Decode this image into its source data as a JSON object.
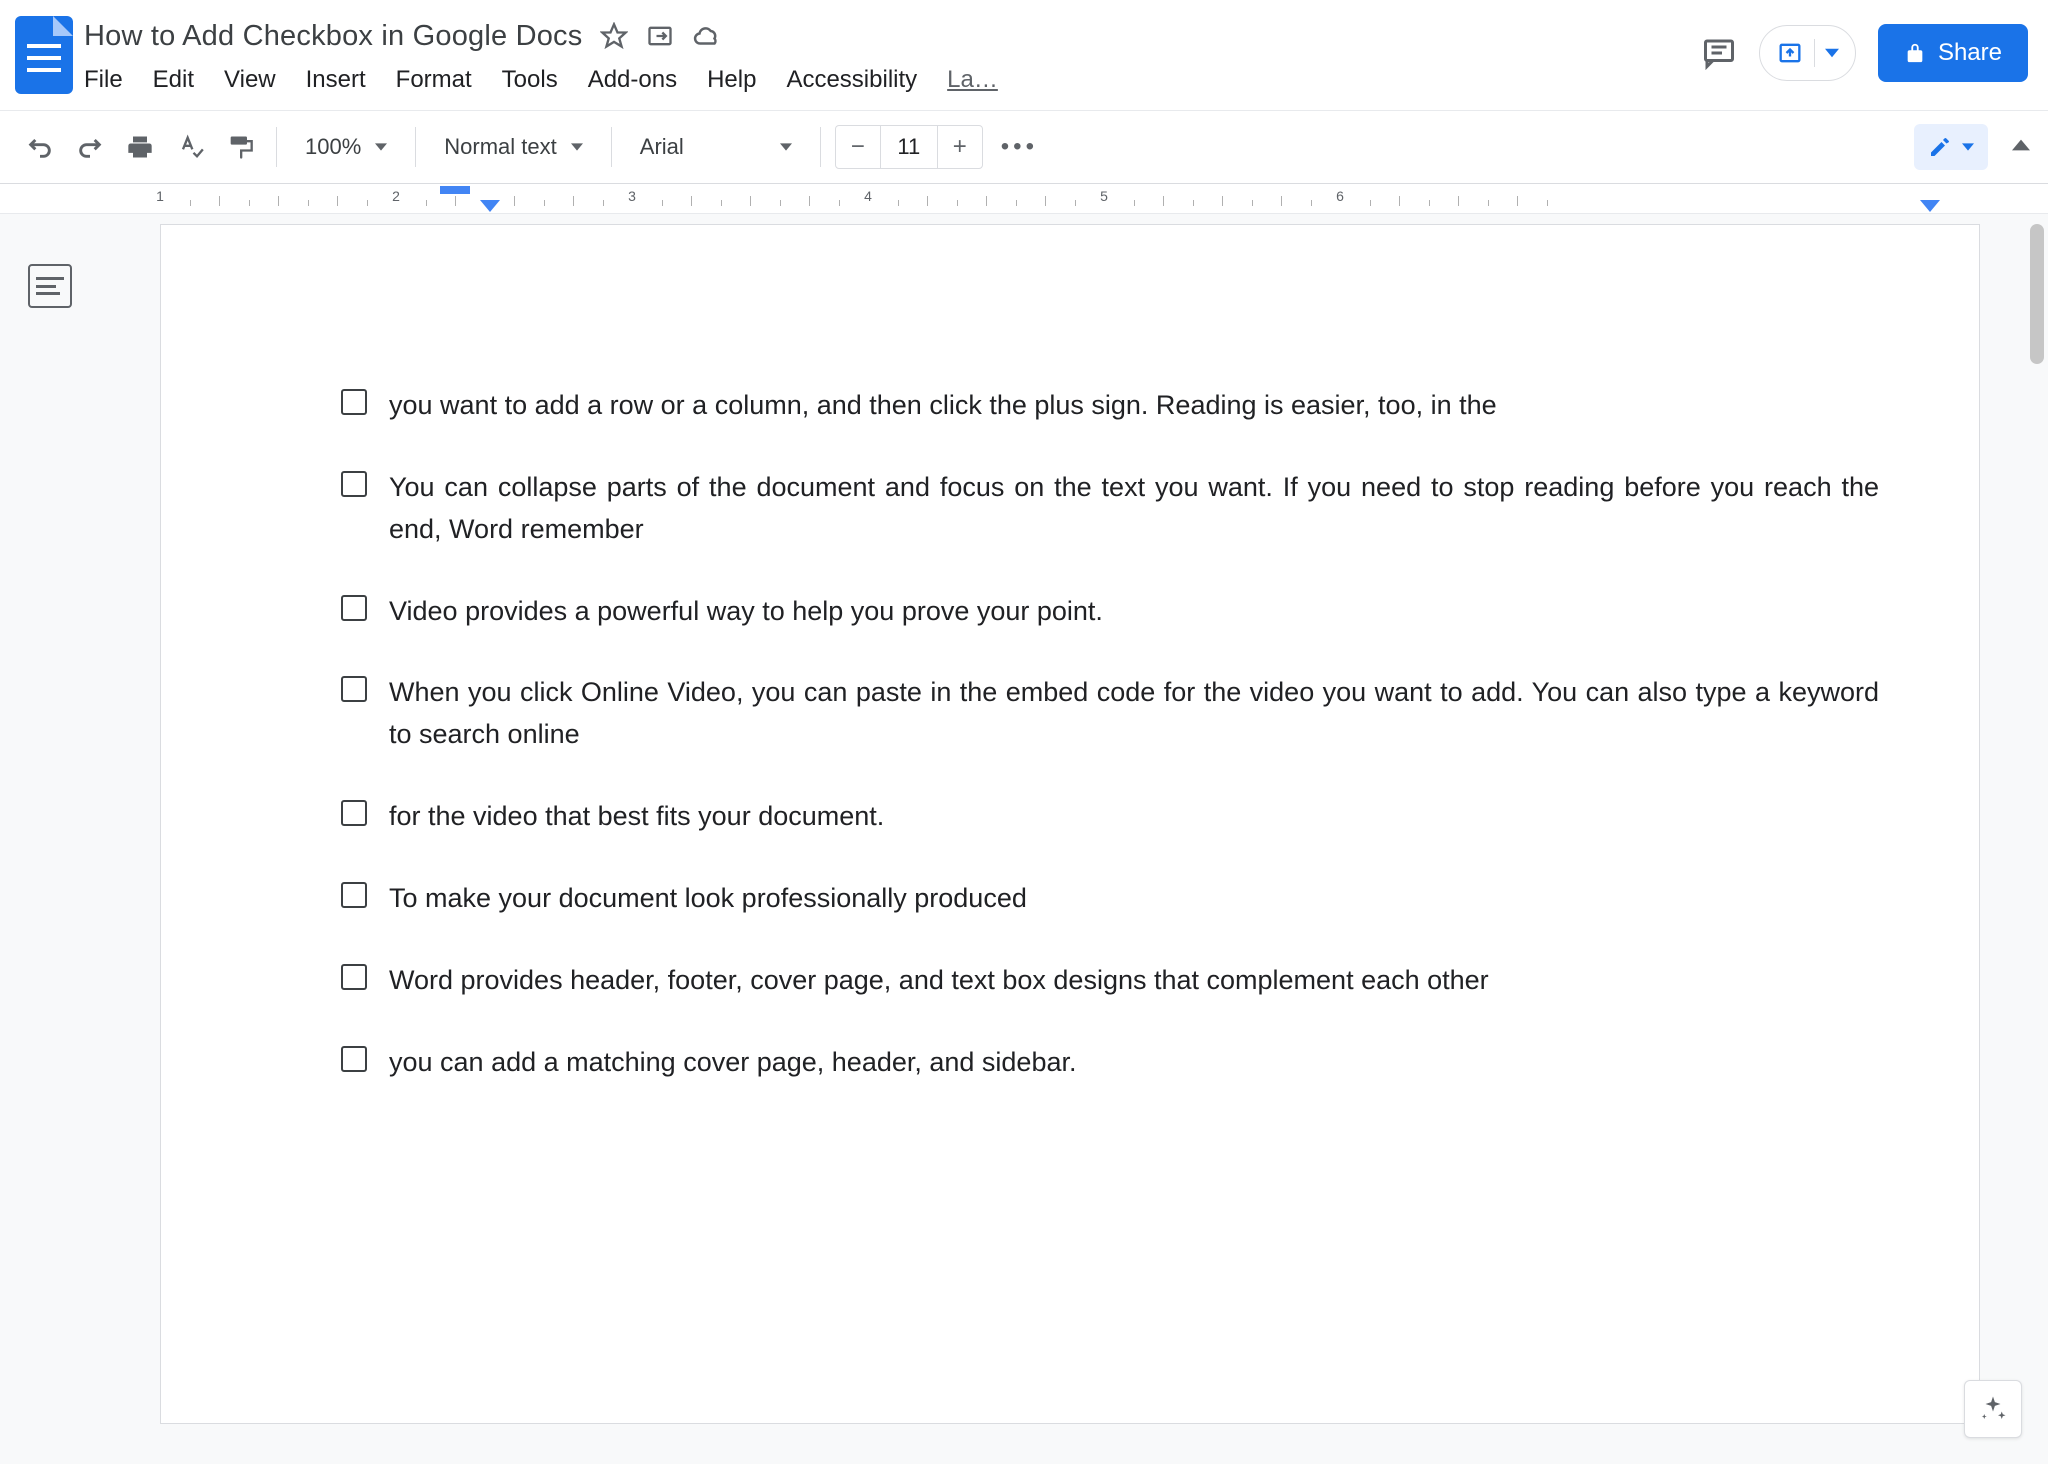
{
  "header": {
    "title": "How to Add Checkbox in Google Docs",
    "share_label": "Share",
    "menus": [
      "File",
      "Edit",
      "View",
      "Insert",
      "Format",
      "Tools",
      "Add-ons",
      "Help",
      "Accessibility",
      "La…"
    ]
  },
  "toolbar": {
    "zoom": "100%",
    "style": "Normal text",
    "font": "Arial",
    "font_size": "11"
  },
  "ruler": {
    "numbers": [
      "1",
      "2",
      "3",
      "4",
      "5",
      "6"
    ]
  },
  "document": {
    "checklist": [
      "you want to add a row or a column, and then click the plus sign. Reading is easier, too, in the",
      "You can collapse parts of the document and focus on the text you want. If you need to stop reading before you reach the end, Word remember",
      " Video provides a powerful way to help you prove your point.",
      "When you click Online Video, you can paste in the embed code for the video you want to add. You can also type a keyword to search online",
      " for the video that best fits your document.",
      "To make your document look professionally produced",
      " Word provides header, footer, cover page, and text box designs that complement each other",
      " you can add a matching cover page, header, and sidebar."
    ]
  }
}
